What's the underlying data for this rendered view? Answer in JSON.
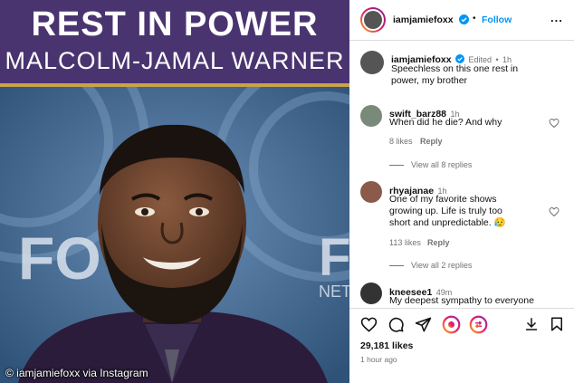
{
  "post_image": {
    "headline": "REST IN POWER",
    "subheadline": "MALCOLM-JAMAL WARNER",
    "credit": "© iamjamiefoxx via Instagram",
    "bg_text_left": "FO",
    "bg_text_right_1": "F",
    "bg_text_right_2": "NET"
  },
  "header": {
    "username": "iamjamiefoxx",
    "separator": "•",
    "follow_label": "Follow",
    "more_label": "..."
  },
  "caption": {
    "username": "iamjamiefoxx",
    "edited": "Edited",
    "dot": "•",
    "time": "1h",
    "text": "Speechless on this one rest in  power, my brother"
  },
  "comments": [
    {
      "username": "swift_barz88",
      "time": "1h",
      "text": "When did he die? And why",
      "likes": "8 likes",
      "reply": "Reply",
      "view_replies": "View all 8 replies"
    },
    {
      "username": "rhyajanae",
      "time": "1h",
      "text": "One of my favorite shows growing up. Life is truly too short and unpredictable. 😥",
      "likes": "113 likes",
      "reply": "Reply",
      "view_replies": "View all 2 replies"
    },
    {
      "username": "kneesee1",
      "time": "49m",
      "text": "My deepest sympathy to everyone"
    }
  ],
  "footer": {
    "likes": "29,181 likes",
    "time": "1 hour ago"
  },
  "colors": {
    "banner": "#4a3470",
    "accent_line": "#c9a34a",
    "follow": "#0095f6",
    "verified": "#0095f6"
  }
}
